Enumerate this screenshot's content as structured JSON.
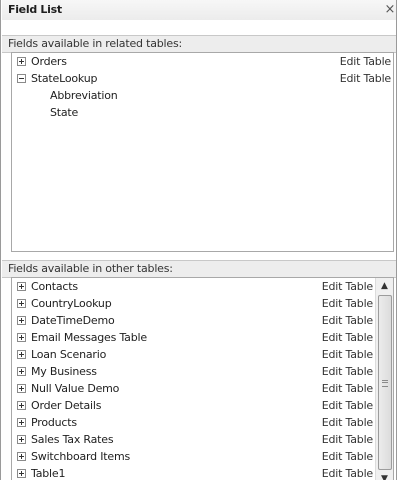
{
  "panel": {
    "title": "Field List",
    "close_glyph": "×"
  },
  "related": {
    "header": "Fields available in related tables:",
    "tables": [
      {
        "name": "Orders",
        "action": "Edit Table",
        "expanded": false,
        "fields": []
      },
      {
        "name": "StateLookup",
        "action": "Edit Table",
        "expanded": true,
        "fields": [
          "Abbreviation",
          "State"
        ]
      }
    ]
  },
  "other": {
    "header": "Fields available in other tables:",
    "tables": [
      {
        "name": "Contacts",
        "action": "Edit Table"
      },
      {
        "name": "CountryLookup",
        "action": "Edit Table"
      },
      {
        "name": "DateTimeDemo",
        "action": "Edit Table"
      },
      {
        "name": "Email Messages Table",
        "action": "Edit Table"
      },
      {
        "name": "Loan Scenario",
        "action": "Edit Table"
      },
      {
        "name": "My Business",
        "action": "Edit Table"
      },
      {
        "name": "Null Value Demo",
        "action": "Edit Table"
      },
      {
        "name": "Order Details",
        "action": "Edit Table"
      },
      {
        "name": "Products",
        "action": "Edit Table"
      },
      {
        "name": "Sales Tax Rates",
        "action": "Edit Table"
      },
      {
        "name": "Switchboard Items",
        "action": "Edit Table"
      },
      {
        "name": "Table1",
        "action": "Edit Table"
      }
    ],
    "scrollbar": {
      "up_glyph": "▲",
      "down_glyph": "▼"
    }
  },
  "icons": {
    "expand": "plus-box-icon",
    "collapse": "minus-box-icon"
  }
}
